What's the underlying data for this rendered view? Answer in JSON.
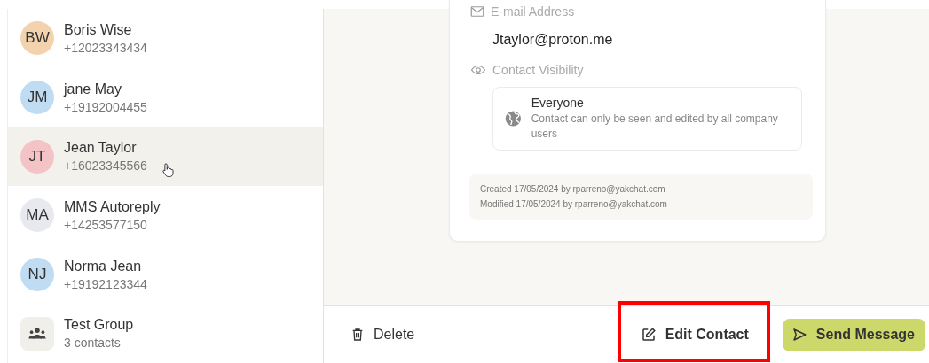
{
  "contacts": [
    {
      "kind": "person",
      "initials": "BW",
      "name": "Boris Wise",
      "detail": "+12023343434",
      "color": "#f2d3ae",
      "selected": false
    },
    {
      "kind": "person",
      "initials": "JM",
      "name": "jane May",
      "detail": "+19192004455",
      "color": "#bfdcf3",
      "selected": false
    },
    {
      "kind": "person",
      "initials": "JT",
      "name": "Jean Taylor",
      "detail": "+16023345566",
      "color": "#f3c3c5",
      "selected": true
    },
    {
      "kind": "person",
      "initials": "MA",
      "name": "MMS Autoreply",
      "detail": "+14253577150",
      "color": "#e8e9ee",
      "selected": false
    },
    {
      "kind": "person",
      "initials": "NJ",
      "name": "Norma Jean",
      "detail": "+19192123344",
      "color": "#bfdcf3",
      "selected": false
    },
    {
      "kind": "group",
      "name": "Test Group",
      "detail": "3 contacts",
      "selected": false
    }
  ],
  "details": {
    "email_label": "E-mail Address",
    "email": "Jtaylor@proton.me",
    "visibility_label": "Contact Visibility",
    "visibility": {
      "title": "Everyone",
      "description": "Contact can only be seen and edited by all company users"
    },
    "meta": [
      "Created 17/05/2024 by rparreno@yakchat.com",
      "Modified 17/05/2024 by rparreno@yakchat.com"
    ]
  },
  "actions": {
    "delete": "Delete",
    "edit": "Edit Contact",
    "send": "Send Message"
  }
}
